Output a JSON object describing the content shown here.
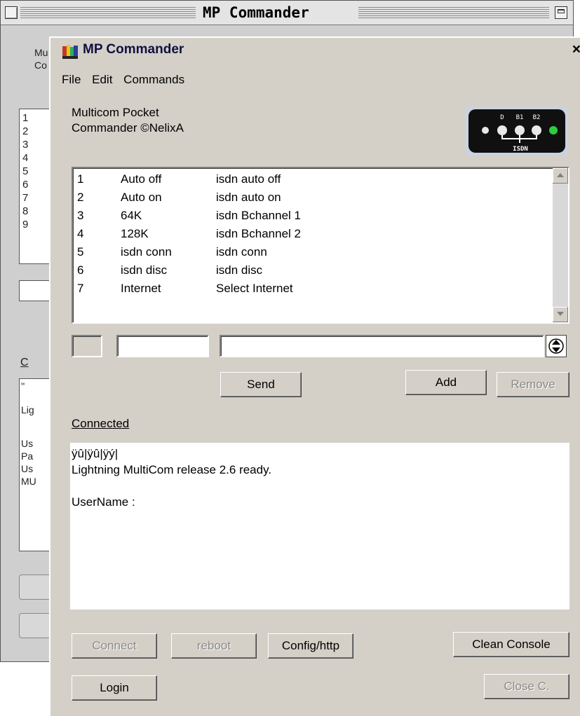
{
  "background_window": {
    "title": "MP Commander",
    "fragments": [
      "Mu",
      "Co",
      "C",
      "''",
      "Lig",
      "Us",
      "Pa",
      "Us",
      "MU"
    ],
    "list_numbers": [
      "1",
      "2",
      "3",
      "4",
      "5",
      "6",
      "7",
      "8",
      "9"
    ]
  },
  "window": {
    "title": "MP Commander",
    "close_glyph": "×"
  },
  "menu": [
    "File",
    "Edit",
    "Commands"
  ],
  "about": {
    "line1": "Multicom Pocket",
    "line2": "Commander ©NelixA"
  },
  "isdn_indicator": {
    "labels": [
      "D",
      "B1",
      "B2"
    ],
    "caption": "ISDN",
    "led_colors": [
      "#e8e8e8",
      "#e8e8e8",
      "#e8e8e8",
      "#2ecc40"
    ]
  },
  "command_list": {
    "rows": [
      {
        "num": "1",
        "name": "Auto off",
        "command": "isdn auto off"
      },
      {
        "num": "2",
        "name": "Auto on",
        "command": "isdn auto on"
      },
      {
        "num": "3",
        "name": "64K",
        "command": "isdn Bchannel 1"
      },
      {
        "num": "4",
        "name": "128K",
        "command": "isdn Bchannel 2"
      },
      {
        "num": "5",
        "name": "isdn conn",
        "command": "isdn conn"
      },
      {
        "num": "6",
        "name": "isdn disc",
        "command": "isdn disc"
      },
      {
        "num": "7",
        "name": "Internet",
        "command": "Select Internet"
      }
    ]
  },
  "editor": {
    "num_value": "",
    "name_value": "",
    "command_value": ""
  },
  "buttons": {
    "send": "Send",
    "add": "Add",
    "remove": "Remove",
    "connect": "Connect",
    "reboot": "reboot",
    "config": "Config/http",
    "clean_console": "Clean Console",
    "login": "Login",
    "close": "Close C."
  },
  "status": "Connected",
  "console_lines": [
    "ÿû|ÿû|ÿý|",
    "Lightning MultiCom release 2.6 ready.",
    "",
    "UserName :"
  ]
}
